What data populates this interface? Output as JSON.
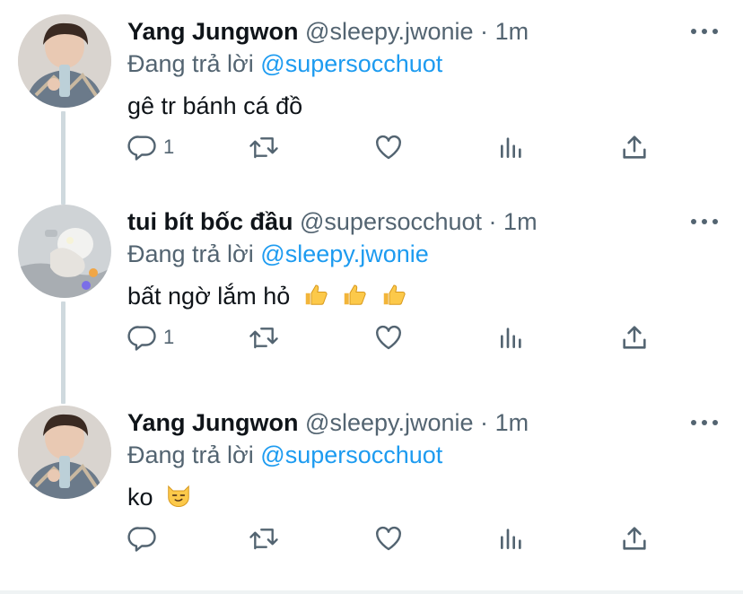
{
  "replying_prefix": "Đang trả lời",
  "tweets": [
    {
      "name": "Yang Jungwon",
      "handle": "@sleepy.jwonie",
      "separator": "·",
      "time": "1m",
      "reply_to": "@supersocchuot",
      "text": "gê tr bánh cá đồ",
      "emoji": [],
      "reply_count": "1",
      "avatar_icon": "profile-photo-jungwon"
    },
    {
      "name": "tui bít bốc đầu",
      "handle": "@supersocchuot",
      "separator": "·",
      "time": "1m",
      "reply_to": "@sleepy.jwonie",
      "text": "bất ngờ lắm hỏ",
      "emoji": [
        "thumbs-up",
        "thumbs-up",
        "thumbs-up"
      ],
      "reply_count": "1",
      "avatar_icon": "profile-photo-toy"
    },
    {
      "name": "Yang Jungwon",
      "handle": "@sleepy.jwonie",
      "separator": "·",
      "time": "1m",
      "reply_to": "@supersocchuot",
      "text": "ko",
      "emoji": [
        "smirking-cat"
      ],
      "reply_count": "",
      "avatar_icon": "profile-photo-jungwon"
    }
  ],
  "colors": {
    "text": "#0f1419",
    "secondary": "#536471",
    "link": "#1d9bf0",
    "thread_line": "#cfd9de"
  }
}
